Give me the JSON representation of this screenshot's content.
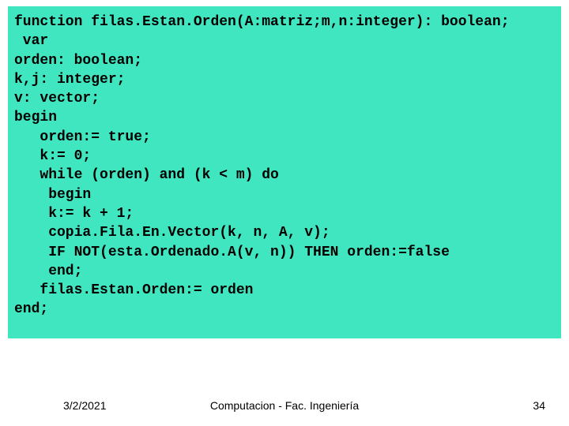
{
  "code": {
    "l01": "function filas.Estan.Orden(A:matriz;m,n:integer): boolean;",
    "l02": " var",
    "l03": "orden: boolean;",
    "l04": "k,j: integer;",
    "l05": "v: vector;",
    "l06": "begin",
    "l07": "   orden:= true;",
    "l08": "   k:= 0;",
    "l09": "   while (orden) and (k < m) do",
    "l10": "    begin",
    "l11": "    k:= k + 1;",
    "l12": "    copia.Fila.En.Vector(k, n, A, v);",
    "l13": "    IF NOT(esta.Ordenado.A(v, n)) THEN orden:=false",
    "l14": "    end;",
    "l15": "   filas.Estan.Orden:= orden",
    "l16": "end;"
  },
  "footer": {
    "date": "3/2/2021",
    "center": "Computacion  - Fac. Ingeniería",
    "page": "34"
  }
}
